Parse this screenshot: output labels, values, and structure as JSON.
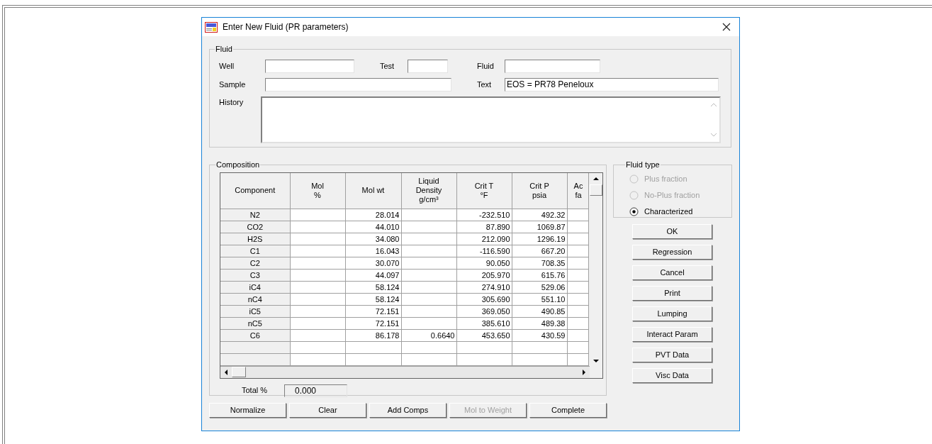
{
  "window": {
    "title": "Enter New Fluid (PR parameters)"
  },
  "fluid_group": {
    "label": "Fluid",
    "fields": [
      {
        "label": "Well"
      },
      {
        "label": "Test"
      },
      {
        "label": "Fluid"
      },
      {
        "label": "Sample"
      },
      {
        "label": "Text",
        "value": "EOS = PR78 Peneloux"
      },
      {
        "label": "History"
      }
    ]
  },
  "composition": {
    "label": "Composition",
    "columns": [
      {
        "lines": [
          "Component"
        ]
      },
      {
        "lines": [
          "Mol",
          "%"
        ]
      },
      {
        "lines": [
          "Mol wt"
        ]
      },
      {
        "lines": [
          "Liquid",
          "Density",
          "g/cm³"
        ]
      },
      {
        "lines": [
          "Crit T",
          "°F"
        ]
      },
      {
        "lines": [
          "Crit P",
          "psia"
        ]
      },
      {
        "lines": [
          "Ac",
          "fa"
        ]
      }
    ],
    "rows": [
      {
        "component": "N2",
        "mol_wt": "28.014",
        "crit_t": "-232.510",
        "crit_p": "492.32"
      },
      {
        "component": "CO2",
        "mol_wt": "44.010",
        "crit_t": "87.890",
        "crit_p": "1069.87"
      },
      {
        "component": "H2S",
        "mol_wt": "34.080",
        "crit_t": "212.090",
        "crit_p": "1296.19"
      },
      {
        "component": "C1",
        "mol_wt": "16.043",
        "crit_t": "-116.590",
        "crit_p": "667.20"
      },
      {
        "component": "C2",
        "mol_wt": "30.070",
        "crit_t": "90.050",
        "crit_p": "708.35"
      },
      {
        "component": "C3",
        "mol_wt": "44.097",
        "crit_t": "205.970",
        "crit_p": "615.76"
      },
      {
        "component": "iC4",
        "mol_wt": "58.124",
        "crit_t": "274.910",
        "crit_p": "529.06"
      },
      {
        "component": "nC4",
        "mol_wt": "58.124",
        "crit_t": "305.690",
        "crit_p": "551.10"
      },
      {
        "component": "iC5",
        "mol_wt": "72.151",
        "crit_t": "369.050",
        "crit_p": "490.85"
      },
      {
        "component": "nC5",
        "mol_wt": "72.151",
        "crit_t": "385.610",
        "crit_p": "489.38"
      },
      {
        "component": "C6",
        "mol_wt": "86.178",
        "liquid_density": "0.6640",
        "crit_t": "453.650",
        "crit_p": "430.59"
      }
    ],
    "total": {
      "label": "Total %",
      "value": "0.000"
    }
  },
  "fluid_type": {
    "label": "Fluid type",
    "options": [
      {
        "label": "Plus fraction",
        "selected": false,
        "disabled": true
      },
      {
        "label": "No-Plus fraction",
        "selected": false,
        "disabled": true
      },
      {
        "label": "Characterized",
        "selected": true,
        "disabled": false
      }
    ]
  },
  "side_buttons": [
    {
      "label": "OK",
      "disabled": false
    },
    {
      "label": "Regression",
      "disabled": false
    },
    {
      "label": "Cancel",
      "disabled": false
    },
    {
      "label": "Print",
      "disabled": false
    },
    {
      "label": "Lumping",
      "disabled": false
    },
    {
      "label": "Interact Param",
      "disabled": false
    },
    {
      "label": "PVT Data",
      "disabled": false
    },
    {
      "label": "Visc Data",
      "disabled": false
    }
  ],
  "bottom_buttons": [
    {
      "label": "Normalize",
      "disabled": false
    },
    {
      "label": "Clear",
      "disabled": false
    },
    {
      "label": "Add Comps",
      "disabled": false
    },
    {
      "label": "Mol to Weight",
      "disabled": true
    },
    {
      "label": "Complete",
      "disabled": false
    }
  ]
}
